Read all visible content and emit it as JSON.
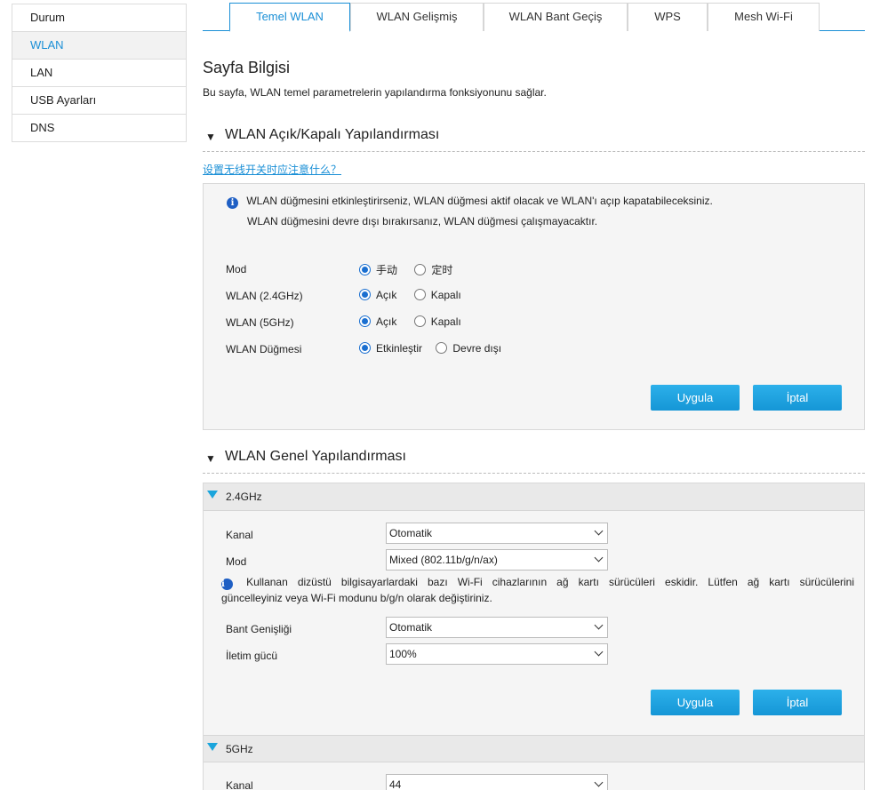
{
  "sidebar": {
    "items": [
      {
        "label": "Durum",
        "active": false
      },
      {
        "label": "WLAN",
        "active": true
      },
      {
        "label": "LAN",
        "active": false
      },
      {
        "label": "USB Ayarları",
        "active": false
      },
      {
        "label": "DNS",
        "active": false
      }
    ]
  },
  "tabs": [
    {
      "label": "Temel WLAN",
      "active": true
    },
    {
      "label": "WLAN Gelişmiş",
      "active": false
    },
    {
      "label": "WLAN Bant Geçiş",
      "active": false
    },
    {
      "label": "WPS",
      "active": false
    },
    {
      "label": "Mesh Wi-Fi",
      "active": false
    }
  ],
  "page": {
    "title": "Sayfa Bilgisi",
    "description": "Bu sayfa, WLAN temel parametrelerin yapılandırma fonksiyonunu sağlar."
  },
  "switch_section": {
    "title": "WLAN Açık/Kapalı Yapılandırması",
    "help_link": "设置无线开关时应注意什么？",
    "note_line1": "WLAN düğmesini etkinleştirirseniz, WLAN düğmesi aktif olacak ve WLAN'ı açıp kapatabileceksiniz.",
    "note_line2": "WLAN düğmesini devre dışı bırakırsanız, WLAN düğmesi çalışmayacaktır.",
    "rows": [
      {
        "label": "Mod",
        "opt1": "手动",
        "opt2": "定时",
        "selected": 1
      },
      {
        "label": "WLAN (2.4GHz)",
        "opt1": "Açık",
        "opt2": "Kapalı",
        "selected": 1
      },
      {
        "label": "WLAN (5GHz)",
        "opt1": "Açık",
        "opt2": "Kapalı",
        "selected": 1
      },
      {
        "label": "WLAN Düğmesi",
        "opt1": "Etkinleştir",
        "opt2": "Devre dışı",
        "selected": 1
      }
    ],
    "apply_label": "Uygula",
    "cancel_label": "İptal"
  },
  "general_section": {
    "title": "WLAN Genel Yapılandırması",
    "band24": {
      "title": "2.4GHz",
      "channel_label": "Kanal",
      "channel_value": "Otomatik",
      "mode_label": "Mod",
      "mode_value": "Mixed (802.11b/g/n/ax)",
      "note_line1": "Kullanan dizüstü bilgisayarlardaki bazı Wi-Fi cihazlarının ağ kartı sürücüleri eskidir. Lütfen ağ kartı sürücülerini",
      "note_line2": "güncelleyiniz veya Wi-Fi modunu b/g/n olarak değiştiriniz.",
      "bandwidth_label": "Bant Genişliği",
      "bandwidth_value": "Otomatik",
      "power_label": "İletim gücü",
      "power_value": "100%",
      "apply_label": "Uygula",
      "cancel_label": "İptal"
    },
    "band5": {
      "title": "5GHz",
      "channel_label": "Kanal",
      "channel_value": "44"
    }
  },
  "colors": {
    "accent": "#1a8fd6",
    "button": "#1596d6",
    "panel_bg": "#f5f5f5"
  }
}
